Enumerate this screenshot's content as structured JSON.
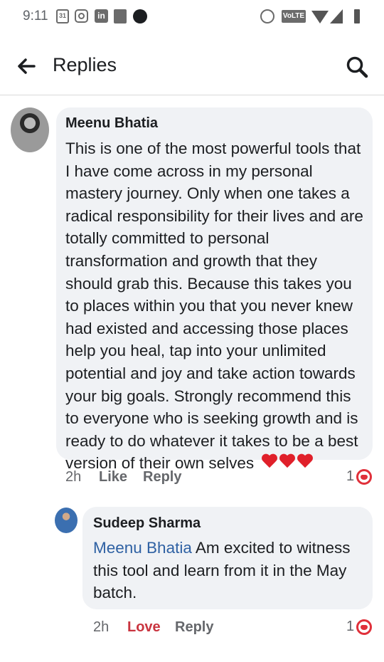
{
  "status_bar": {
    "time": "9:11",
    "calendar_day": "31",
    "linkedin": "in",
    "volte": "VoLTE"
  },
  "header": {
    "title": "Replies"
  },
  "comment": {
    "author": "Meenu Bhatia",
    "text": "This is one of the most powerful tools that I have come across in my personal mastery journey.  Only when one takes a radical responsibility for their lives and are totally committed to personal transformation and growth that they should grab this. Because this takes you to places within you that you never knew had existed and accessing those places help you heal, tap into your unlimited potential and joy and take action towards your big goals. Strongly recommend this to everyone who is seeking growth and is ready to do whatever it takes to be a best version of their own selves",
    "emoji": "❤❤❤",
    "time": "2h",
    "like_label": "Like",
    "reply_label": "Reply",
    "reaction_count": "1",
    "reaction_icon": "love-reaction-icon",
    "reaction_color": "#e0303a"
  },
  "reply": {
    "author": "Sudeep Sharma",
    "mention": "Meenu Bhatia",
    "text": " Am excited to witness this tool and learn from it in the May batch.",
    "time": "2h",
    "like_label": "Love",
    "reply_label": "Reply",
    "reaction_count": "1",
    "reaction_icon": "love-reaction-icon",
    "liked_color": "#c9343f",
    "mention_color": "#2f61a3"
  }
}
